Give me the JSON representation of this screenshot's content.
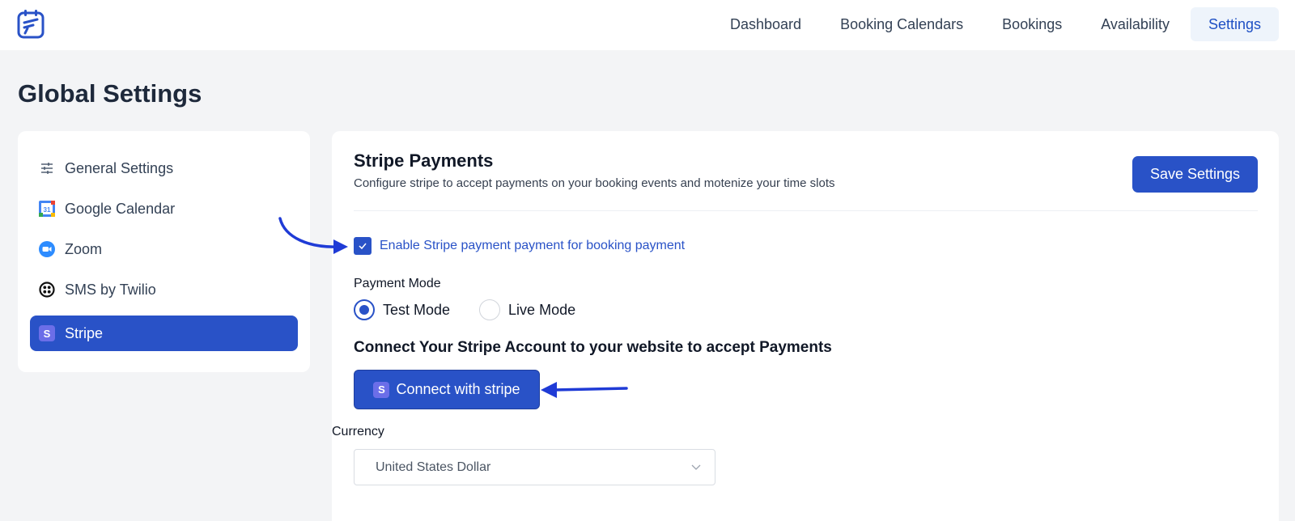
{
  "nav": {
    "items": [
      {
        "label": "Dashboard"
      },
      {
        "label": "Booking Calendars"
      },
      {
        "label": "Bookings"
      },
      {
        "label": "Availability"
      },
      {
        "label": "Settings",
        "active": true
      }
    ]
  },
  "page": {
    "title": "Global Settings"
  },
  "sidebar": {
    "items": [
      {
        "label": "General Settings",
        "icon": "sliders-icon"
      },
      {
        "label": "Google Calendar",
        "icon": "google-calendar-icon",
        "icon_text": "31"
      },
      {
        "label": "Zoom",
        "icon": "zoom-icon"
      },
      {
        "label": "SMS by Twilio",
        "icon": "twilio-icon"
      },
      {
        "label": "Stripe",
        "icon": "stripe-icon",
        "icon_text": "S",
        "active": true
      }
    ]
  },
  "panel": {
    "title": "Stripe Payments",
    "subtitle": "Configure stripe to accept payments on your booking events and motenize your time slots",
    "save_label": "Save Settings",
    "enable_label": "Enable Stripe payment payment for booking payment",
    "enable_checked": true,
    "mode_label": "Payment Mode",
    "modes": [
      {
        "label": "Test Mode",
        "selected": true
      },
      {
        "label": "Live Mode",
        "selected": false
      }
    ],
    "connect_heading": "Connect Your Stripe Account to your website to accept Payments",
    "connect_label": "Connect with stripe",
    "connect_icon_text": "S",
    "currency_label": "Currency",
    "currency_value": "United States Dollar"
  },
  "colors": {
    "accent": "#2952c7",
    "annotation_arrow": "#1f3bd6",
    "background": "#f3f4f6"
  }
}
